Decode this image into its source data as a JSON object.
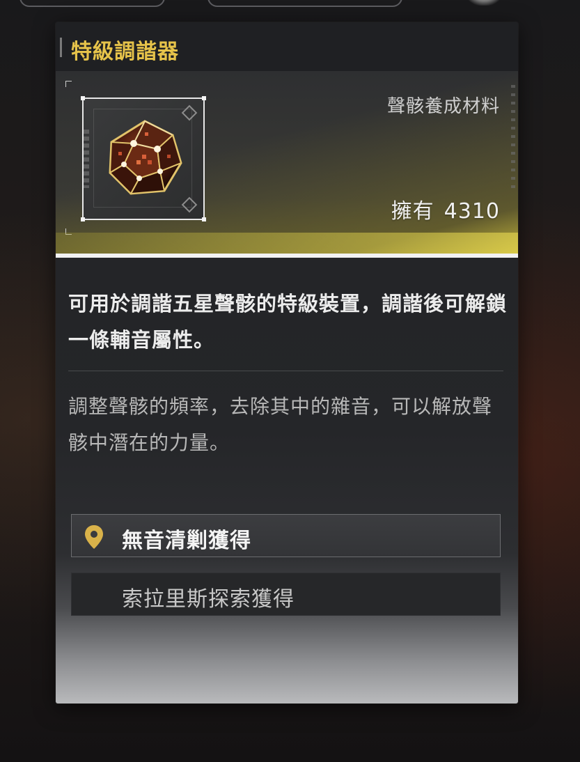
{
  "item": {
    "name": "特級調諧器",
    "category": "聲骸養成材料",
    "owned_label": "擁有",
    "owned_count": "4310",
    "description": "可用於調諧五星聲骸的特級裝置，調諧後可解鎖一條輔音屬性。",
    "lore": "調整聲骸的頻率，去除其中的雜音，可以解放聲骸中潛在的力量。"
  },
  "sources": [
    {
      "label": "無音清剿獲得",
      "icon": "map-pin-icon"
    },
    {
      "label": "索拉里斯探索獲得"
    }
  ],
  "colors": {
    "title": "#e6c34a",
    "pin": "#d9b24a",
    "hero_glow": "#e6d750"
  }
}
